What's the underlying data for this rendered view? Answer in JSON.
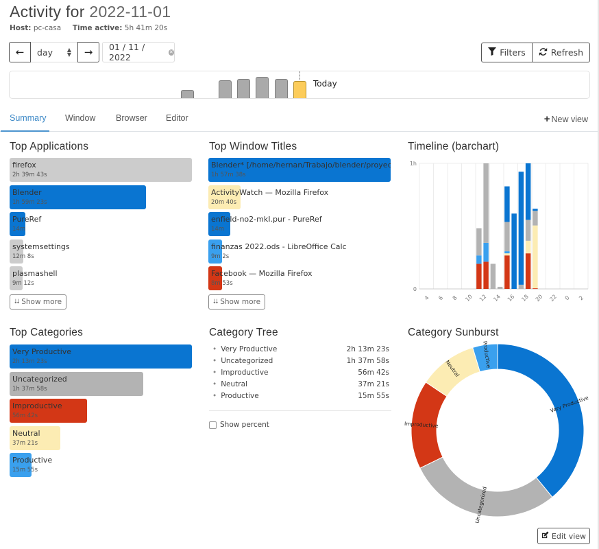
{
  "header": {
    "title_prefix": "Activity for",
    "title_date": "2022-11-01",
    "host_label": "Host:",
    "host_value": "pc-casa",
    "time_active_label": "Time active:",
    "time_active_value": "5h 41m 20s"
  },
  "controls": {
    "prev_icon": "arrow-left-icon",
    "next_icon": "arrow-right-icon",
    "period_select": "day",
    "date_value": "01 / 11 / 2022",
    "filters_label": "Filters",
    "refresh_label": "Refresh"
  },
  "period_bar": {
    "today_label": "Today",
    "relative_heights": [
      0.45,
      0,
      0.85,
      0.9,
      1.0,
      0.9,
      0.82
    ],
    "today_index": 6
  },
  "tabs": [
    {
      "label": "Summary",
      "active": true
    },
    {
      "label": "Window",
      "active": false
    },
    {
      "label": "Browser",
      "active": false
    },
    {
      "label": "Editor",
      "active": false
    }
  ],
  "new_view_label": "New view",
  "colors": {
    "very_productive": "#0a75d1",
    "uncategorized": "#b3b3b3",
    "improductive": "#d33716",
    "neutral": "#fcecb3",
    "productive": "#3aa0ee",
    "tab_active": "#3a87c6"
  },
  "top_applications": {
    "title": "Top Applications",
    "show_more": "Show more",
    "items": [
      {
        "name": "firefox",
        "duration": "2h 39m 43s",
        "fraction": 1.0,
        "color": "#cccccc"
      },
      {
        "name": "Blender",
        "duration": "1h 59m 23s",
        "fraction": 0.747,
        "color": "#0a75d1"
      },
      {
        "name": "PureRef",
        "duration": "14m",
        "fraction": 0.088,
        "color": "#0a75d1"
      },
      {
        "name": "systemsettings",
        "duration": "12m 8s",
        "fraction": 0.076,
        "color": "#cccccc"
      },
      {
        "name": "plasmashell",
        "duration": "9m 12s",
        "fraction": 0.058,
        "color": "#cccccc"
      }
    ]
  },
  "top_window_titles": {
    "title": "Top Window Titles",
    "show_more": "Show more",
    "items": [
      {
        "name": "Blender* [/home/hernan/Trabajo/blender/proyecto",
        "duration": "1h 57m 38s",
        "fraction": 1.0,
        "color": "#0a75d1"
      },
      {
        "name": "ActivityWatch — Mozilla Firefox",
        "duration": "20m 40s",
        "fraction": 0.176,
        "color": "#fcecb3"
      },
      {
        "name": "enfield-no2-mkI.pur - PureRef",
        "duration": "14m",
        "fraction": 0.119,
        "color": "#0a75d1"
      },
      {
        "name": "finanzas 2022.ods - LibreOffice Calc",
        "duration": "9m 2s",
        "fraction": 0.077,
        "color": "#3aa0ee"
      },
      {
        "name": "Facebook — Mozilla Firefox",
        "duration": "8m 53s",
        "fraction": 0.076,
        "color": "#d33716"
      }
    ]
  },
  "top_categories": {
    "title": "Top Categories",
    "items": [
      {
        "name": "Very Productive",
        "duration": "2h 13m 23s",
        "fraction": 1.0,
        "color": "#0a75d1"
      },
      {
        "name": "Uncategorized",
        "duration": "1h 37m 58s",
        "fraction": 0.734,
        "color": "#b3b3b3"
      },
      {
        "name": "Improductive",
        "duration": "56m 42s",
        "fraction": 0.425,
        "color": "#d33716"
      },
      {
        "name": "Neutral",
        "duration": "37m 21s",
        "fraction": 0.28,
        "color": "#fcecb3"
      },
      {
        "name": "Productive",
        "duration": "15m 55s",
        "fraction": 0.119,
        "color": "#3aa0ee"
      }
    ]
  },
  "category_tree": {
    "title": "Category Tree",
    "rows": [
      {
        "name": "Very Productive",
        "duration": "2h 13m 23s"
      },
      {
        "name": "Uncategorized",
        "duration": "1h 37m 58s"
      },
      {
        "name": "Improductive",
        "duration": "56m 42s"
      },
      {
        "name": "Neutral",
        "duration": "37m 21s"
      },
      {
        "name": "Productive",
        "duration": "15m 55s"
      }
    ],
    "show_percent_label": "Show percent",
    "show_percent_checked": false
  },
  "edit_view_label": "Edit view",
  "chart_data": [
    {
      "type": "bar",
      "stacked": true,
      "title": "Timeline (barchart)",
      "xlabel": "",
      "ylabel": "",
      "ylim": [
        0,
        60
      ],
      "y_unit": "minutes",
      "y_tick_labels": [
        "0",
        "1h"
      ],
      "x_tick_labels": [
        "4",
        "6",
        "8",
        "10",
        "12",
        "14",
        "16",
        "18",
        "20",
        "22",
        "0",
        "2"
      ],
      "hours": [
        11,
        12,
        13,
        14,
        15,
        16,
        17,
        18,
        19
      ],
      "series": [
        {
          "name": "Improductive",
          "color": "#d33716",
          "values": [
            12,
            13,
            0,
            0,
            16,
            0,
            0,
            17,
            0.3
          ]
        },
        {
          "name": "Neutral",
          "color": "#fcecb3",
          "values": [
            0,
            0,
            0,
            0,
            1,
            0,
            0,
            6,
            30
          ]
        },
        {
          "name": "Productive",
          "color": "#3aa0ee",
          "values": [
            4,
            9,
            0,
            0,
            1,
            0,
            0,
            0,
            0
          ]
        },
        {
          "name": "Uncategorized",
          "color": "#b3b3b3",
          "values": [
            13,
            38,
            12,
            1,
            14,
            0,
            2,
            10,
            7
          ]
        },
        {
          "name": "Very Productive",
          "color": "#0a75d1",
          "values": [
            0,
            0,
            0,
            0,
            17,
            36,
            54,
            27,
            1
          ]
        }
      ],
      "grid": true
    },
    {
      "type": "pie",
      "title": "Category Sunburst",
      "donut": true,
      "labels": [
        "Very Productive",
        "Uncategorized",
        "Improductive",
        "Neutral",
        "Productive"
      ],
      "values": [
        133.4,
        98.0,
        56.7,
        37.4,
        15.9
      ],
      "colors": [
        "#0a75d1",
        "#b3b3b3",
        "#d33716",
        "#fcecb3",
        "#3aa0ee"
      ]
    }
  ]
}
